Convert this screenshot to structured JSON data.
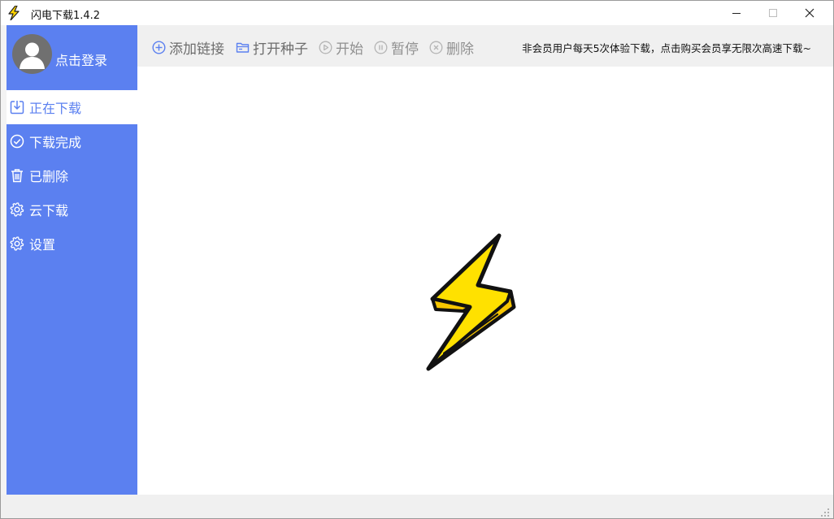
{
  "window": {
    "title": "闪电下载1.4.2",
    "controls": [
      "minimize",
      "maximize",
      "close"
    ]
  },
  "sidebar": {
    "login_text": "点击登录",
    "items": [
      {
        "label": "正在下载",
        "icon": "download-icon",
        "active": true
      },
      {
        "label": "下载完成",
        "icon": "check-circle-icon",
        "active": false
      },
      {
        "label": "已删除",
        "icon": "trash-icon",
        "active": false
      },
      {
        "label": "云下载",
        "icon": "gear-icon",
        "active": false
      },
      {
        "label": "设置",
        "icon": "gear-icon",
        "active": false
      }
    ]
  },
  "toolbar": {
    "add_link": "添加链接",
    "open_torrent": "打开种子",
    "start": "开始",
    "pause": "暂停",
    "delete": "删除",
    "notice": "非会员用户每天5次体验下载，点击购买会员享无限次高速下载~"
  },
  "colors": {
    "accent": "#5b80f0",
    "toolbar_bg": "#f0f0f0",
    "logo_yellow": "#ffe100"
  }
}
